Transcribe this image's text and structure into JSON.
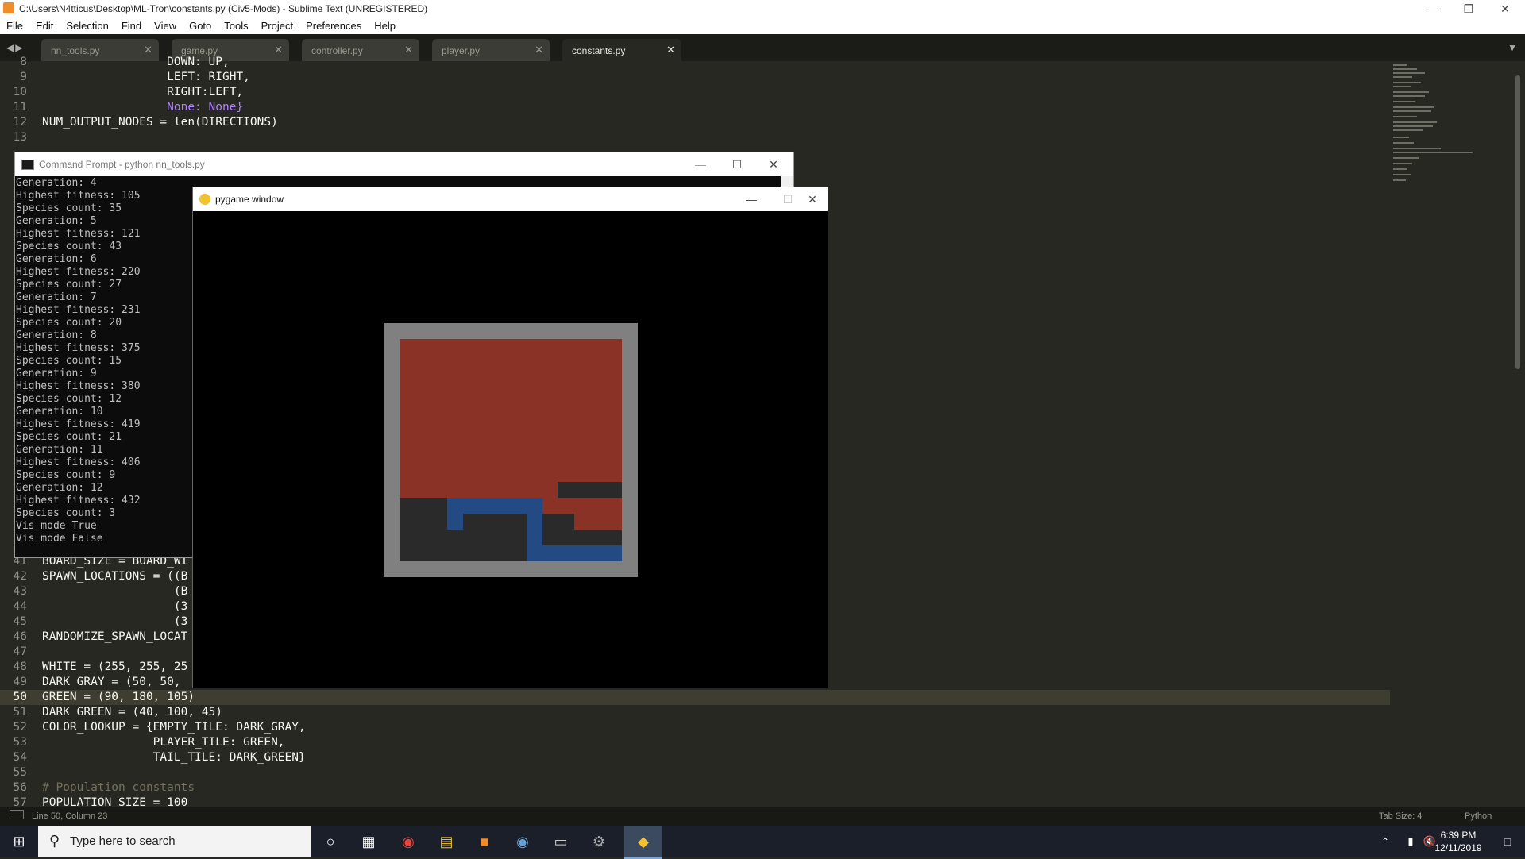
{
  "sublime": {
    "title": "C:\\Users\\N4tticus\\Desktop\\ML-Tron\\constants.py (Civ5-Mods) - Sublime Text (UNREGISTERED)",
    "menu": [
      "File",
      "Edit",
      "Selection",
      "Find",
      "View",
      "Goto",
      "Tools",
      "Project",
      "Preferences",
      "Help"
    ],
    "tabs": [
      {
        "label": "nn_tools.py"
      },
      {
        "label": "game.py"
      },
      {
        "label": "controller.py"
      },
      {
        "label": "player.py"
      },
      {
        "label": "constants.py"
      }
    ],
    "status_left": "Line 50, Column 23",
    "status_tab": "Tab Size: 4",
    "status_lang": "Python"
  },
  "code": {
    "top": [
      {
        "n": "8",
        "t": "                  DOWN: UP,"
      },
      {
        "n": "9",
        "t": "                  LEFT: RIGHT,"
      },
      {
        "n": "10",
        "t": "                  RIGHT:LEFT,"
      },
      {
        "n": "11",
        "t": "                  None: None}"
      },
      {
        "n": "12",
        "t": "NUM_OUTPUT_NODES = len(DIRECTIONS)"
      },
      {
        "n": "13",
        "t": ""
      }
    ],
    "bottom": [
      {
        "n": "41",
        "t": "BOARD_SIZE = BOARD_WI"
      },
      {
        "n": "42",
        "t": "SPAWN_LOCATIONS = ((B"
      },
      {
        "n": "43",
        "t": "                   (B"
      },
      {
        "n": "44",
        "t": "                   (3"
      },
      {
        "n": "45",
        "t": "                   (3"
      },
      {
        "n": "46",
        "t": "RANDOMIZE_SPAWN_LOCAT"
      },
      {
        "n": "47",
        "t": ""
      },
      {
        "n": "48",
        "t": "WHITE = (255, 255, 25"
      },
      {
        "n": "49",
        "t": "DARK_GRAY = (50, 50, "
      },
      {
        "n": "50",
        "t": "GREEN = (90, 180, 105)"
      },
      {
        "n": "51",
        "t": "DARK_GREEN = (40, 100, 45)"
      },
      {
        "n": "52",
        "t": "COLOR_LOOKUP = {EMPTY_TILE: DARK_GRAY,"
      },
      {
        "n": "53",
        "t": "                PLAYER_TILE: GREEN,"
      },
      {
        "n": "54",
        "t": "                TAIL_TILE: DARK_GREEN}"
      },
      {
        "n": "55",
        "t": ""
      },
      {
        "n": "56",
        "t": "# Population constants"
      },
      {
        "n": "57",
        "t": "POPULATION_SIZE = 100"
      }
    ]
  },
  "cmd": {
    "title": "Command Prompt - python  nn_tools.py",
    "lines": [
      "Generation: 4",
      "Highest fitness: 105",
      "Species count: 35",
      "Generation: 5",
      "Highest fitness: 121",
      "Species count: 43",
      "Generation: 6",
      "Highest fitness: 220",
      "Species count: 27",
      "Generation: 7",
      "Highest fitness: 231",
      "Species count: 20",
      "Generation: 8",
      "Highest fitness: 375",
      "Species count: 15",
      "Generation: 9",
      "Highest fitness: 380",
      "Species count: 12",
      "Generation: 10",
      "Highest fitness: 419",
      "Species count: 21",
      "Generation: 11",
      "Highest fitness: 406",
      "Species count: 9",
      "Generation: 12",
      "Highest fitness: 432",
      "Species count: 3",
      "Vis mode True",
      "Vis mode False"
    ]
  },
  "pygame": {
    "title": "pygame window",
    "colors": {
      "border": "#808080",
      "red": "#8b3226",
      "dark": "#2a2a2a",
      "blue": "#234a82"
    }
  },
  "taskbar": {
    "search_placeholder": "Type here to search",
    "time": "6:39 PM",
    "date": "12/11/2019",
    "icons": [
      "cortana-icon",
      "task-view-icon",
      "chrome-icon",
      "file-explorer-icon",
      "sublime-text-icon",
      "steam-icon",
      "terminal-icon",
      "app-icon",
      "python-icon"
    ]
  }
}
